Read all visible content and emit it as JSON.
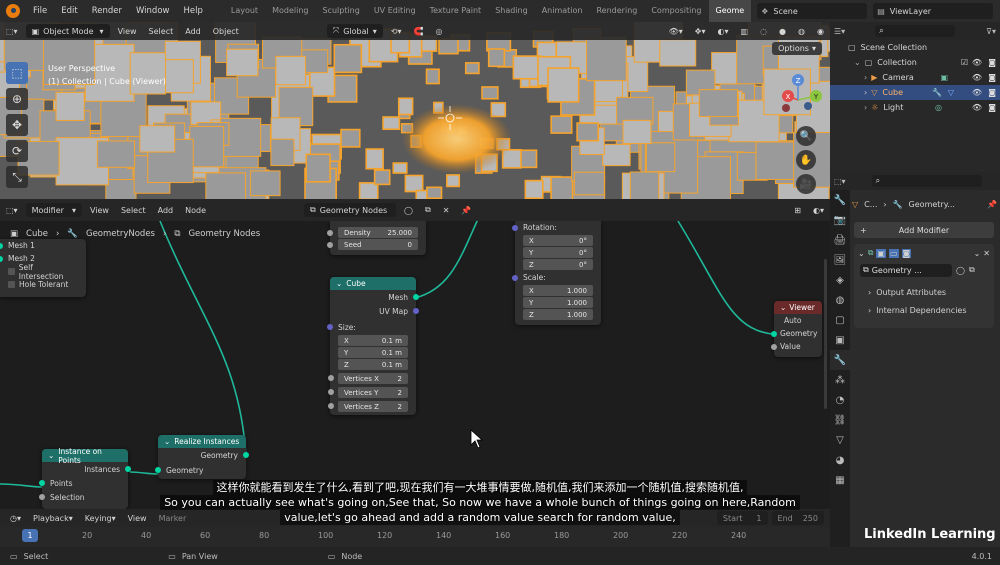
{
  "topbar": {
    "menu": [
      "File",
      "Edit",
      "Render",
      "Window",
      "Help"
    ],
    "workspaces": [
      "Layout",
      "Modeling",
      "Sculpting",
      "UV Editing",
      "Texture Paint",
      "Shading",
      "Animation",
      "Rendering",
      "Compositing",
      "Geome"
    ],
    "active_workspace": "Geome",
    "scene": "Scene",
    "view_layer": "ViewLayer"
  },
  "viewport": {
    "header": {
      "mode": "Object Mode",
      "view": "View",
      "select": "Select",
      "add": "Add",
      "object": "Object",
      "orientation": "Global",
      "options": "Options"
    },
    "perspective": "User Perspective",
    "collection_info": "(1) Collection | Cube (Viewer)",
    "gizmo": {
      "x": "X",
      "y": "Y",
      "z": "Z"
    },
    "colors": {
      "orange": "#f5a32c",
      "cube_gray": "#9a9a9a",
      "header": "#282828"
    }
  },
  "node_editor": {
    "header": {
      "type": "Modifier",
      "view": "View",
      "select": "Select",
      "add": "Add",
      "node": "Node",
      "tree_name": "Geometry Nodes"
    },
    "breadcrumb": [
      "Cube",
      "GeometryNodes",
      "Geometry Nodes"
    ],
    "mesh_boolean_partial": {
      "rows": [
        "Mesh 1",
        "Mesh 2",
        "Self Intersection",
        "Hole Tolerant"
      ]
    },
    "distribute_partial": {
      "density_label": "Density",
      "density": "25.000",
      "seed_label": "Seed",
      "seed": "0"
    },
    "transform_partial": {
      "rotation_label": "Rotation:",
      "rotation": [
        {
          "axis": "X",
          "value": "0°"
        },
        {
          "axis": "Y",
          "value": "0°"
        },
        {
          "axis": "Z",
          "value": "0°"
        }
      ],
      "scale_label": "Scale:",
      "scale": [
        {
          "axis": "X",
          "value": "1.000"
        },
        {
          "axis": "Y",
          "value": "1.000"
        },
        {
          "axis": "Z",
          "value": "1.000"
        }
      ]
    },
    "cube_node": {
      "title": "Cube",
      "out_mesh": "Mesh",
      "out_uv": "UV Map",
      "size_label": "Size:",
      "size": [
        {
          "axis": "X",
          "value": "0.1 m"
        },
        {
          "axis": "Y",
          "value": "0.1 m"
        },
        {
          "axis": "Z",
          "value": "0.1 m"
        }
      ],
      "vertices": [
        {
          "label": "Vertices X",
          "value": "2"
        },
        {
          "label": "Vertices Y",
          "value": "2"
        },
        {
          "label": "Vertices Z",
          "value": "2"
        }
      ]
    },
    "viewer_node": {
      "title": "Viewer",
      "domain": "Auto",
      "geometry": "Geometry",
      "value": "Value"
    },
    "realize_node": {
      "title": "Realize Instances",
      "geometry": "Geometry",
      "in_geometry": "Geometry"
    },
    "iop_node": {
      "title": "Instance on Points",
      "instances": "Instances",
      "points": "Points",
      "selection": "Selection"
    }
  },
  "outliner": {
    "title": "Scene Collection",
    "rows": [
      {
        "name": "Collection"
      },
      {
        "name": "Camera"
      },
      {
        "name": "Cube"
      },
      {
        "name": "Light"
      }
    ]
  },
  "properties": {
    "object_short": "C...",
    "modifier_name": "Geometry...",
    "add_modifier": "Add Modifier",
    "modifier_tree": "Geometry ...",
    "output_attributes": "Output Attributes",
    "internal_dependencies": "Internal Dependencies"
  },
  "timeline": {
    "playback": "Playback",
    "keying": "Keying",
    "view": "View",
    "marker": "Marker",
    "current_frame": "1",
    "start_label": "Start",
    "start": "1",
    "end_label": "End",
    "end": "250",
    "ticks": [
      "20",
      "40",
      "60",
      "80",
      "100",
      "120",
      "140",
      "160",
      "180",
      "200",
      "220",
      "240"
    ]
  },
  "statusbar": {
    "select": "Select",
    "pan_view": "Pan View",
    "node": "Node",
    "version": "4.0.1"
  },
  "subtitle": {
    "zh": "这样你就能看到发生了什么,看到了吧,现在我们有一大堆事情要做,随机值,我们来添加一个随机值,搜索随机值,",
    "en1": "So you can actually see what's going on,See that, So now we have a whole bunch of things going on here,Random",
    "en2": "value,let's go ahead and add a random value search for random value,"
  },
  "watermark": "LinkedIn Learning"
}
